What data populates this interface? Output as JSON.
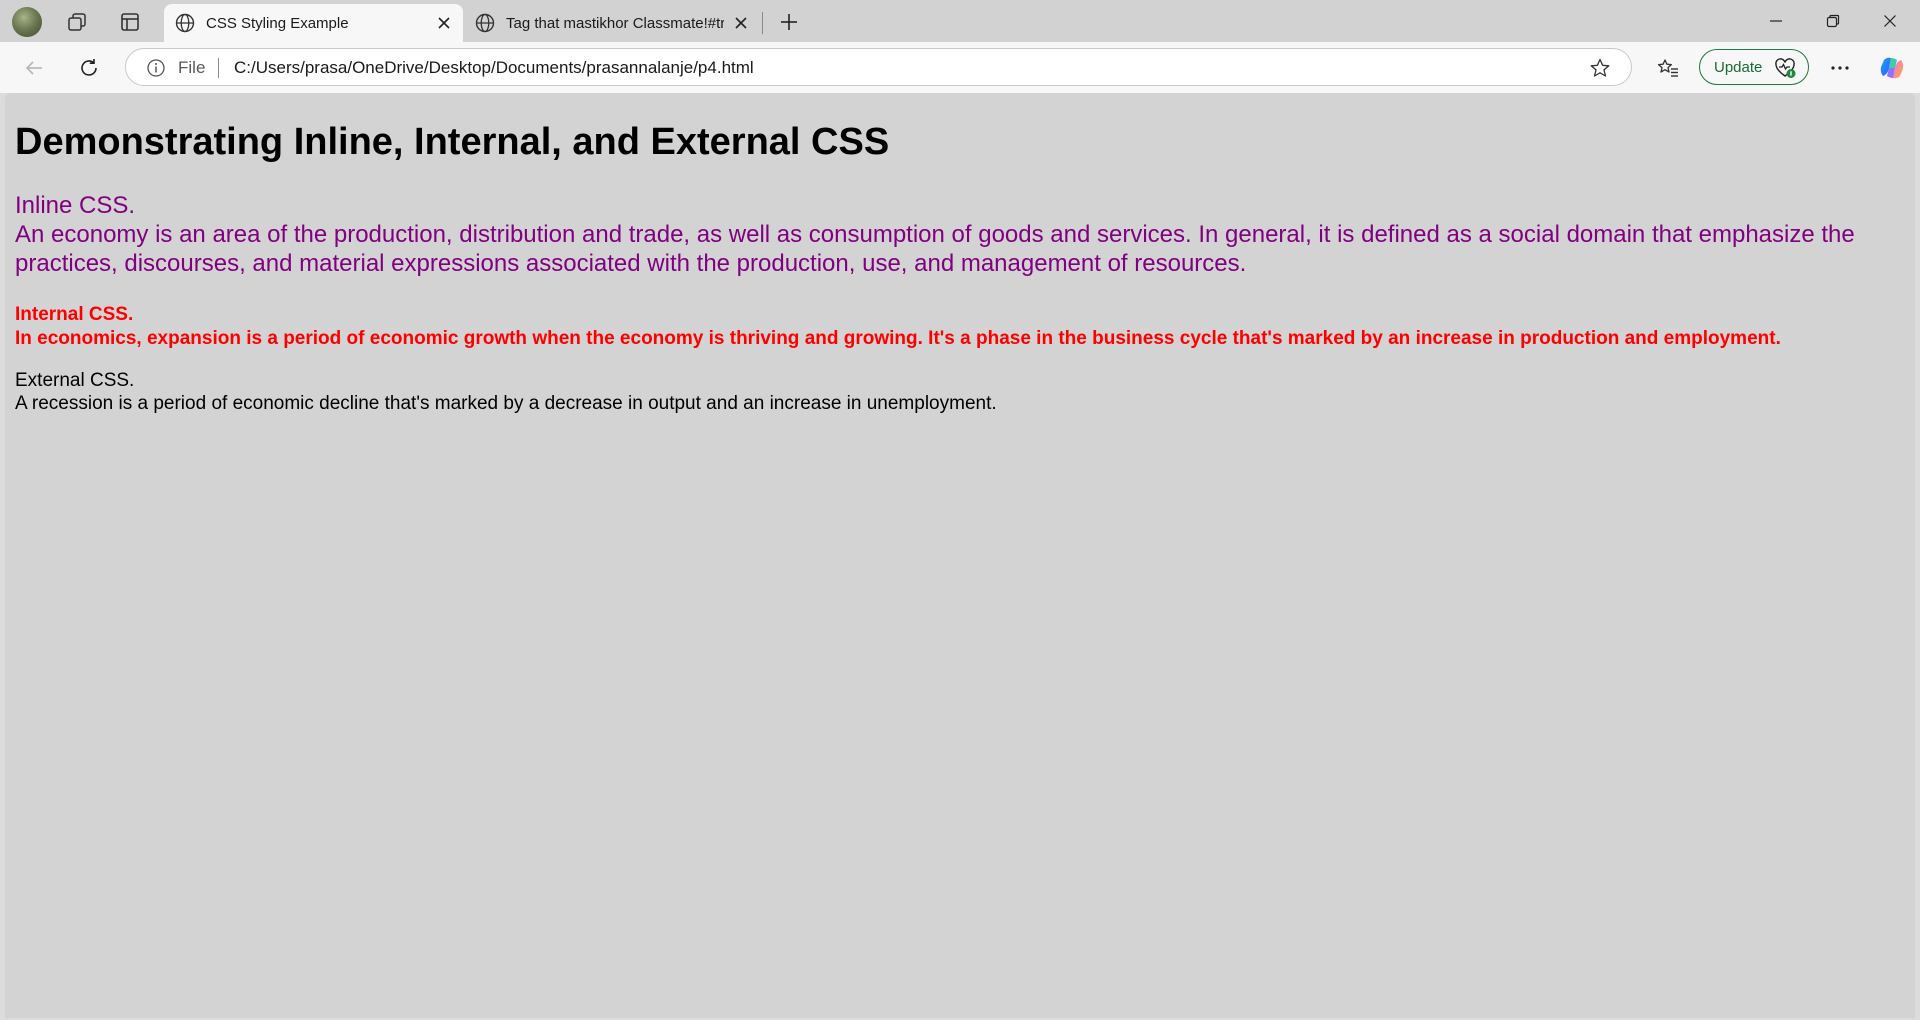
{
  "browser": {
    "tabs": [
      {
        "title": "CSS Styling Example",
        "active": true
      },
      {
        "title": "Tag that mastikhor Classmate!#tr",
        "active": false
      }
    ],
    "address": {
      "protocol_label": "File",
      "url": "C:/Users/prasa/OneDrive/Desktop/Documents/prasannalanje/p4.html"
    },
    "update_button": "Update"
  },
  "colors": {
    "inline": "#800080",
    "internal": "#ff0000",
    "external": "#000000",
    "page_background": "#d3d3d3"
  },
  "page": {
    "heading": "Demonstrating Inline, Internal, and External CSS",
    "inline": {
      "title": "Inline CSS.",
      "text": "An economy is an area of the production, distribution and trade, as well as consumption of goods and services. In general, it is defined as a social domain that emphasize the practices, discourses, and material expressions associated with the production, use, and management of resources."
    },
    "internal": {
      "title": "Internal CSS.",
      "text": "In economics, expansion is a period of economic growth when the economy is thriving and growing. It's a phase in the business cycle that's marked by an increase in production and employment."
    },
    "external": {
      "title": "External CSS.",
      "text": "A recession is a period of economic decline that's marked by a decrease in output and an increase in unemployment."
    }
  }
}
